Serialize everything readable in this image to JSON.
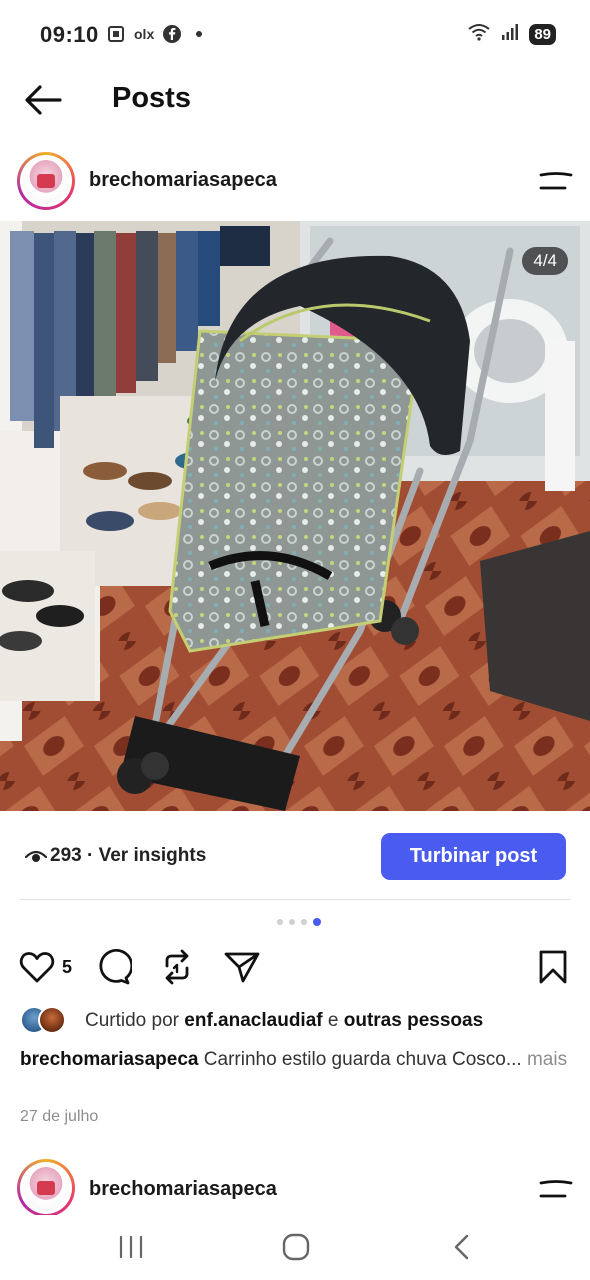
{
  "status_bar": {
    "time": "09:10",
    "left_icons": [
      "screenshot-icon",
      "olx-icon",
      "facebook-icon",
      "notification-dot"
    ],
    "olx_label": "olx",
    "battery": "89"
  },
  "header": {
    "title": "Posts"
  },
  "post": {
    "username": "brechomariasapeca",
    "slide_counter": "4/4",
    "views": "293",
    "insights_label": "· Ver insights",
    "boost_label": "Turbinar post",
    "pagination": {
      "total": 4,
      "active_index": 3
    },
    "like_count": "5",
    "likes_prefix": "Curtido por",
    "liked_by_user": "enf.anaclaudiaf",
    "likes_conjunction": "e",
    "likes_others": "outras pessoas",
    "caption_user": "brechomariasapeca",
    "caption_text": "Carrinho estilo guarda chuva Cosco...",
    "caption_more": "mais",
    "date": "27 de julho"
  },
  "next_post": {
    "username": "brechomariasapeca"
  },
  "colors": {
    "accent": "#4a5cf0",
    "text": "#111111",
    "muted": "#8e8e8e"
  }
}
